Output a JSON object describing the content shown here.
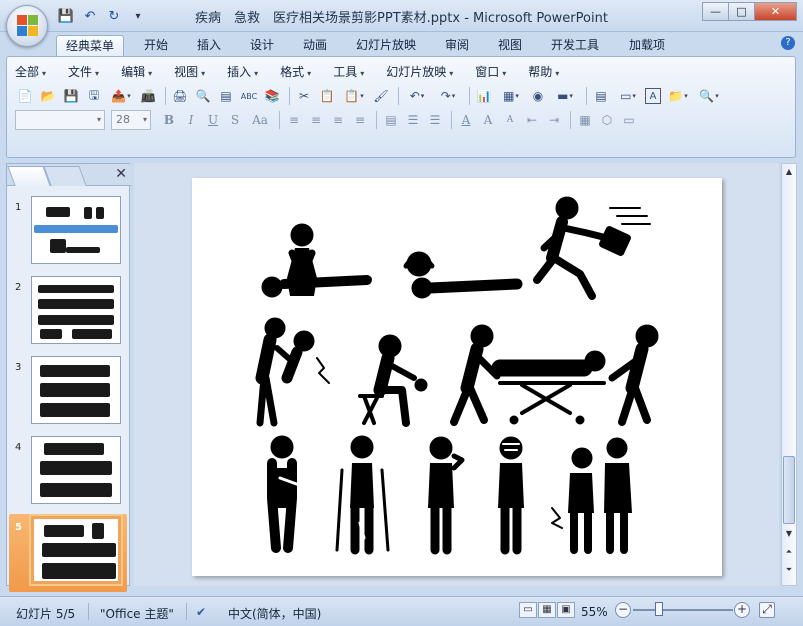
{
  "window": {
    "title": "疾病　急救　医疗相关场景剪影PPT素材.pptx - Microsoft PowerPoint",
    "minimize": "—",
    "maximize": "□",
    "close": "✕"
  },
  "quick_access": {
    "save_icon": "💾",
    "undo_icon": "↶",
    "redo_icon": "↻",
    "customize_icon": "▾"
  },
  "ribbon_tabs": [
    "经典菜单",
    "开始",
    "插入",
    "设计",
    "动画",
    "幻灯片放映",
    "审阅",
    "视图",
    "开发工具",
    "加载项"
  ],
  "help_icon": "?",
  "classic_menu": [
    "全部",
    "文件",
    "编辑",
    "视图",
    "插入",
    "格式",
    "工具",
    "幻灯片放映",
    "窗口",
    "帮助"
  ],
  "toolbar_row1": [
    "📄",
    "📂",
    "💾",
    "🖫",
    "📤",
    "📠",
    "🖨",
    "🔍",
    "▤",
    "ABC",
    "📚",
    "✂",
    "📋",
    "📋",
    "🖌",
    "↶",
    "↷",
    "📊",
    "▦",
    "◉",
    "▬",
    "▤",
    "▭",
    "A",
    "📁",
    "🔍"
  ],
  "toolbar_row2": {
    "font_value": "",
    "size_value": "28",
    "format_buttons": [
      "B",
      "I",
      "U",
      "S",
      "Aa"
    ],
    "align_buttons": [
      "≡",
      "≡",
      "≡",
      "≡",
      "▤",
      "☰",
      "☰",
      "A",
      "A",
      "A",
      "⇤",
      "⇥",
      "▦",
      "⬡",
      "▭"
    ]
  },
  "panel": {
    "close_icon": "✕",
    "slide_numbers": [
      "1",
      "2",
      "3",
      "4",
      "5"
    ],
    "selected_slide": 5
  },
  "status": {
    "slide_info": "幻灯片 5/5",
    "theme": "\"Office 主题\"",
    "spell_icon": "✔",
    "language": "中文(简体，中国)",
    "zoom": "55%",
    "zoom_out": "−",
    "zoom_in": "+",
    "fit_icon": "⤢"
  },
  "colors": {
    "accent": "#f0a35b",
    "ribbon_bg": "#e3ecf8",
    "frame_bg": "#c9d9ee"
  }
}
